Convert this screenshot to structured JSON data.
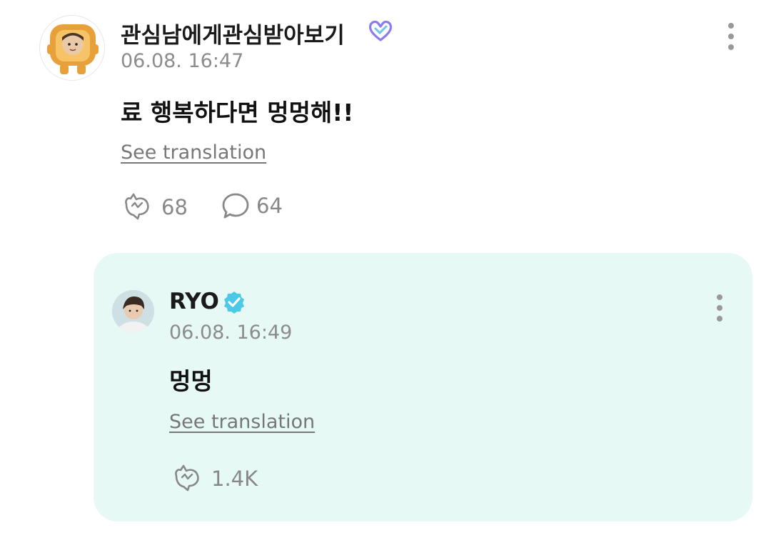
{
  "post": {
    "author": "관심남에게관심받아보기",
    "timestamp": "06.08. 16:47",
    "text": "료 행복하다면 멍멍해!!",
    "translate_label": "See translation",
    "like_count": "68",
    "comment_count": "64",
    "badge_icon": "heart-badge-icon",
    "badge_color": "#8a7cf0"
  },
  "reply": {
    "author": "RYO",
    "timestamp": "06.08. 16:49",
    "text": "멍멍",
    "translate_label": "See translation",
    "like_count": "1.4K",
    "badge_icon": "verified-check-icon",
    "badge_color": "#4cc9e6",
    "background": "#e6f9f5"
  }
}
